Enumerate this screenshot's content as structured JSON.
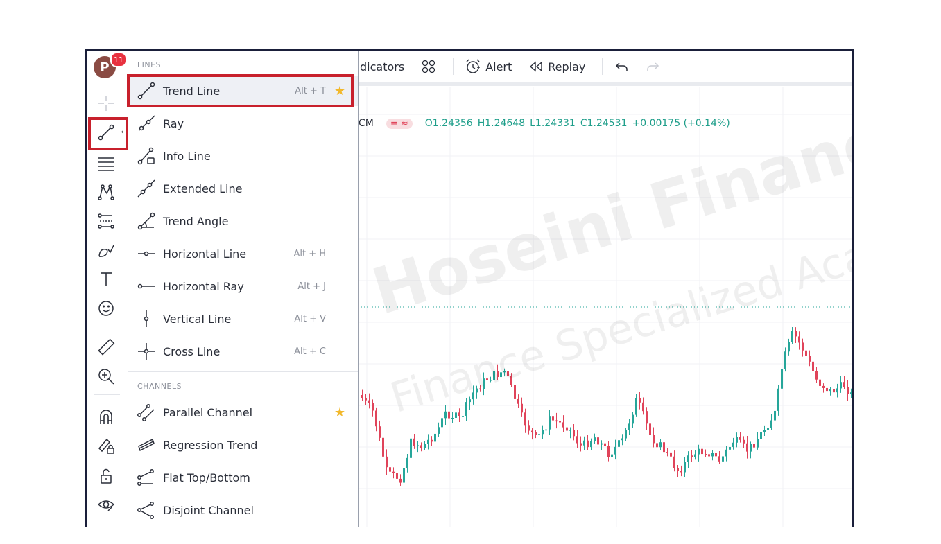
{
  "user": {
    "avatar_letter": "P",
    "notification_count": "11"
  },
  "menu": {
    "sections": [
      {
        "title": "LINES",
        "items": [
          {
            "label": "Trend Line",
            "shortcut": "Alt + T",
            "icon": "trend-line-icon",
            "starred": true,
            "selected": true
          },
          {
            "label": "Ray",
            "shortcut": "",
            "icon": "ray-icon",
            "starred": false
          },
          {
            "label": "Info Line",
            "shortcut": "",
            "icon": "info-line-icon",
            "starred": false
          },
          {
            "label": "Extended Line",
            "shortcut": "",
            "icon": "extended-line-icon",
            "starred": false
          },
          {
            "label": "Trend Angle",
            "shortcut": "",
            "icon": "trend-angle-icon",
            "starred": false
          },
          {
            "label": "Horizontal Line",
            "shortcut": "Alt + H",
            "icon": "horizontal-line-icon",
            "starred": false
          },
          {
            "label": "Horizontal Ray",
            "shortcut": "Alt + J",
            "icon": "horizontal-ray-icon",
            "starred": false
          },
          {
            "label": "Vertical Line",
            "shortcut": "Alt + V",
            "icon": "vertical-line-icon",
            "starred": false
          },
          {
            "label": "Cross Line",
            "shortcut": "Alt + C",
            "icon": "cross-line-icon",
            "starred": false
          }
        ]
      },
      {
        "title": "CHANNELS",
        "items": [
          {
            "label": "Parallel Channel",
            "shortcut": "",
            "icon": "parallel-channel-icon",
            "starred": true
          },
          {
            "label": "Regression Trend",
            "shortcut": "",
            "icon": "regression-trend-icon",
            "starred": false
          },
          {
            "label": "Flat Top/Bottom",
            "shortcut": "",
            "icon": "flat-top-bottom-icon",
            "starred": false
          },
          {
            "label": "Disjoint Channel",
            "shortcut": "",
            "icon": "disjoint-channel-icon",
            "starred": false
          }
        ]
      }
    ]
  },
  "topbar": {
    "indicators_label": "dicators",
    "alert_label": "Alert",
    "replay_label": "Replay"
  },
  "legend": {
    "symbol_fragment": "CM",
    "pill": "= ≈",
    "open": "O1.24356",
    "high": "H1.24648",
    "low": "L1.24331",
    "close": "C1.24531",
    "change": "+0.00175 (+0.14%)"
  },
  "watermark": {
    "line1": "Hoseini Finance",
    "line2": "Finance Specialized Academy"
  },
  "colors": {
    "accent_red": "#c8202c",
    "up_candle": "#26a69a",
    "down_candle": "#e0445a",
    "star": "#f2b82b",
    "badge": "#e8313f"
  }
}
